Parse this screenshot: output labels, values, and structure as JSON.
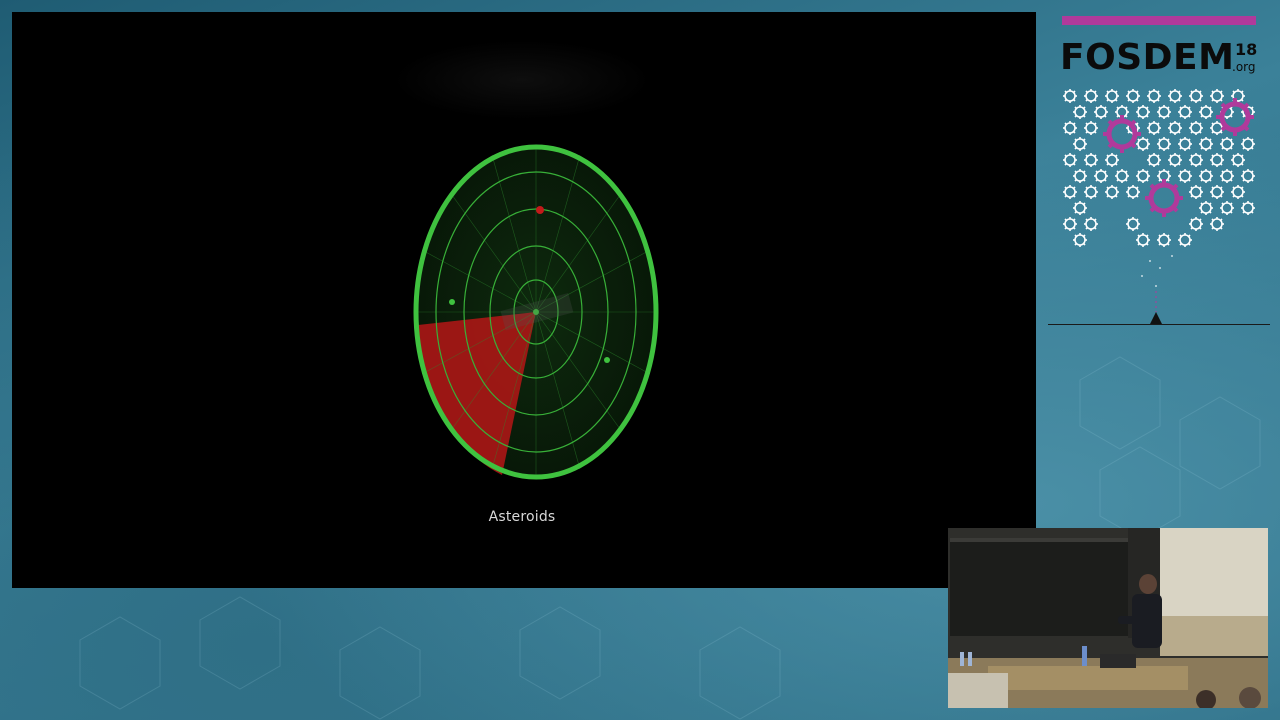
{
  "slide": {
    "caption": "Asteroids",
    "radar": {
      "ring_color": "#3fc23f",
      "sweep_color": "#c21a1a"
    }
  },
  "branding": {
    "name": "FOSDEM",
    "year": "18",
    "tld": ".org",
    "accent_color": "#b03a9b"
  },
  "camera": {
    "description_icon": "presenter-video-feed"
  }
}
